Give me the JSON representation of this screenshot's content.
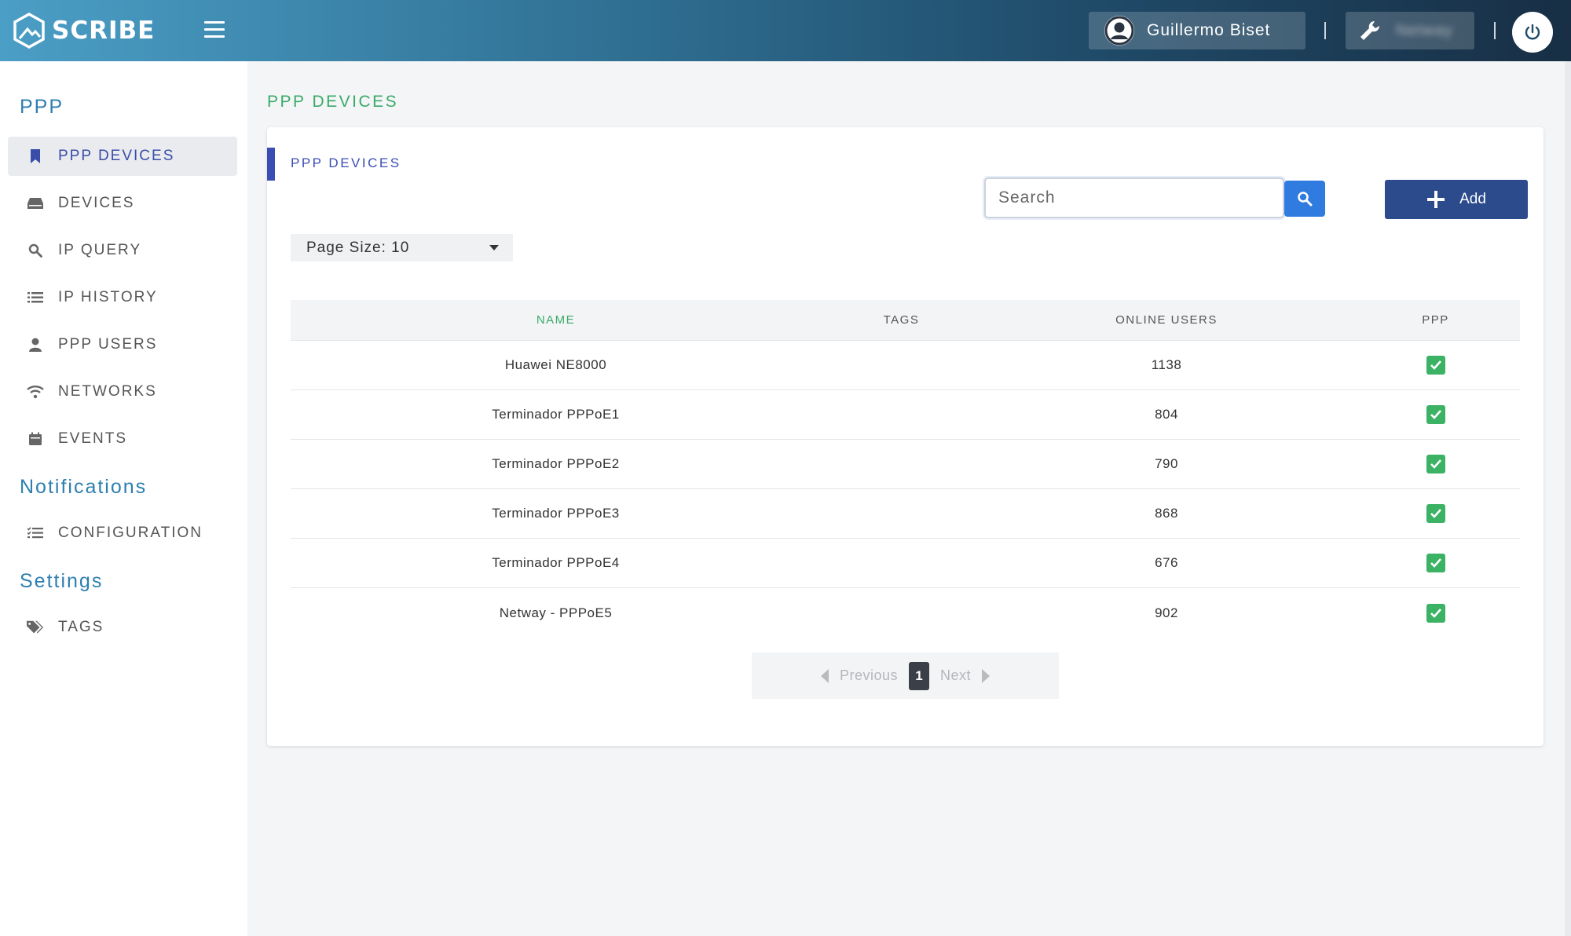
{
  "header": {
    "logo_text": "SCRIBE",
    "user_name": "Guillermo Biset",
    "org_name": "Netway"
  },
  "sidebar": {
    "sections": [
      {
        "title": "PPP"
      },
      {
        "title": "Notifications"
      },
      {
        "title": "Settings"
      }
    ],
    "items": [
      {
        "label": "PPP DEVICES",
        "icon": "bookmark-icon",
        "active": true
      },
      {
        "label": "DEVICES",
        "icon": "hard-drive-icon"
      },
      {
        "label": "IP QUERY",
        "icon": "search-icon"
      },
      {
        "label": "IP HISTORY",
        "icon": "list-icon"
      },
      {
        "label": "PPP USERS",
        "icon": "user-icon"
      },
      {
        "label": "NETWORKS",
        "icon": "wifi-icon"
      },
      {
        "label": "EVENTS",
        "icon": "calendar-icon"
      },
      {
        "label": "CONFIGURATION",
        "icon": "checklist-icon"
      },
      {
        "label": "TAGS",
        "icon": "tags-icon"
      }
    ]
  },
  "main": {
    "page_title": "PPP DEVICES",
    "card_title": "PPP DEVICES",
    "search_placeholder": "Search",
    "add_label": "Add",
    "page_size_label": "Page Size: 10",
    "table": {
      "columns": [
        "NAME",
        "TAGS",
        "ONLINE USERS",
        "PPP"
      ],
      "rows": [
        {
          "name": "Huawei NE8000",
          "tags": "",
          "online_users": "1138",
          "ppp": true
        },
        {
          "name": "Terminador PPPoE1",
          "tags": "",
          "online_users": "804",
          "ppp": true
        },
        {
          "name": "Terminador PPPoE2",
          "tags": "",
          "online_users": "790",
          "ppp": true
        },
        {
          "name": "Terminador PPPoE3",
          "tags": "",
          "online_users": "868",
          "ppp": true
        },
        {
          "name": "Terminador PPPoE4",
          "tags": "",
          "online_users": "676",
          "ppp": true
        },
        {
          "name": "Netway - PPPoE5",
          "tags": "",
          "online_users": "902",
          "ppp": true
        }
      ]
    },
    "pagination": {
      "previous_label": "Previous",
      "current_page": "1",
      "next_label": "Next"
    }
  },
  "colors": {
    "accent_green": "#3aaa68",
    "accent_blue": "#3a4db2",
    "add_button": "#2b4b8c",
    "search_button": "#2f7be0"
  }
}
